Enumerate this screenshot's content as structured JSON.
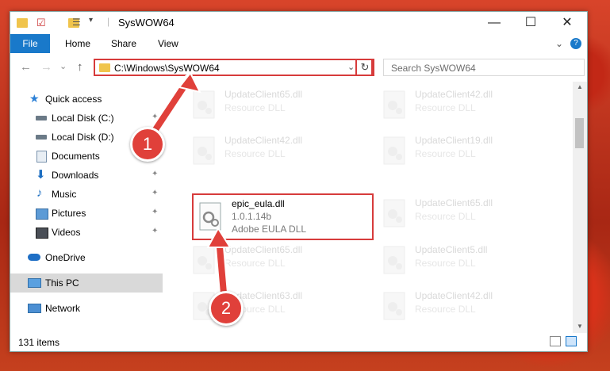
{
  "window": {
    "title": "SysWOW64",
    "controls": {
      "minimize": "—",
      "maximize": "☐",
      "close": "✕",
      "collapse": "⌄",
      "help": "?"
    }
  },
  "ribbon": {
    "tabs": [
      {
        "label": "File"
      },
      {
        "label": "Home"
      },
      {
        "label": "Share"
      },
      {
        "label": "View"
      }
    ]
  },
  "navigation": {
    "back": "←",
    "forward": "→",
    "recent": "⌄",
    "up": "↑",
    "address": "C:\\Windows\\SysWOW64",
    "address_dropdown": "⌄",
    "refresh": "↻",
    "search_placeholder": "Search SysWOW64"
  },
  "sidebar": {
    "items": [
      {
        "label": "Quick access",
        "icon": "star-icon"
      },
      {
        "label": "Local Disk (C:)",
        "icon": "drive-icon",
        "pinned": true
      },
      {
        "label": "Local Disk (D:)",
        "icon": "drive-icon",
        "pinned": true
      },
      {
        "label": "Documents",
        "icon": "documents-icon",
        "pinned": true
      },
      {
        "label": "Downloads",
        "icon": "downloads-icon",
        "pinned": true
      },
      {
        "label": "Music",
        "icon": "music-icon",
        "pinned": true
      },
      {
        "label": "Pictures",
        "icon": "pictures-icon",
        "pinned": true
      },
      {
        "label": "Videos",
        "icon": "videos-icon",
        "pinned": true
      },
      {
        "label": "OneDrive",
        "icon": "cloud-icon"
      },
      {
        "label": "This PC",
        "icon": "computer-icon",
        "selected": true
      },
      {
        "label": "Network",
        "icon": "network-icon"
      }
    ],
    "pin_glyph": "📌"
  },
  "files": [
    {
      "name": "UpdateClient65.dll",
      "type": "Resource DLL"
    },
    {
      "name": "UpdateClient42.dll",
      "type": "Resource DLL"
    },
    {
      "name": "UpdateClient42.dll",
      "type": "Resource DLL"
    },
    {
      "name": "UpdateClient19.dll",
      "type": "Resource DLL"
    },
    {
      "name": "epic_eula.dll",
      "version": "1.0.1.14b",
      "type": "Adobe EULA DLL",
      "highlighted": true
    },
    {
      "name": "UpdateClient65.dll",
      "type": "Resource DLL"
    },
    {
      "name": "UpdateClient65.dll",
      "type": "Resource DLL"
    },
    {
      "name": "UpdateClient5.dll",
      "type": "Resource DLL"
    },
    {
      "name": "UpdateClient63.dll",
      "type": "Resource DLL"
    },
    {
      "name": "UpdateClient42.dll",
      "type": "Resource DLL"
    }
  ],
  "status": {
    "item_count": "131 items"
  },
  "callouts": [
    "1",
    "2"
  ],
  "colors": {
    "accent": "#1979ca",
    "highlight": "#d73b3b",
    "callout": "#e0403a"
  }
}
